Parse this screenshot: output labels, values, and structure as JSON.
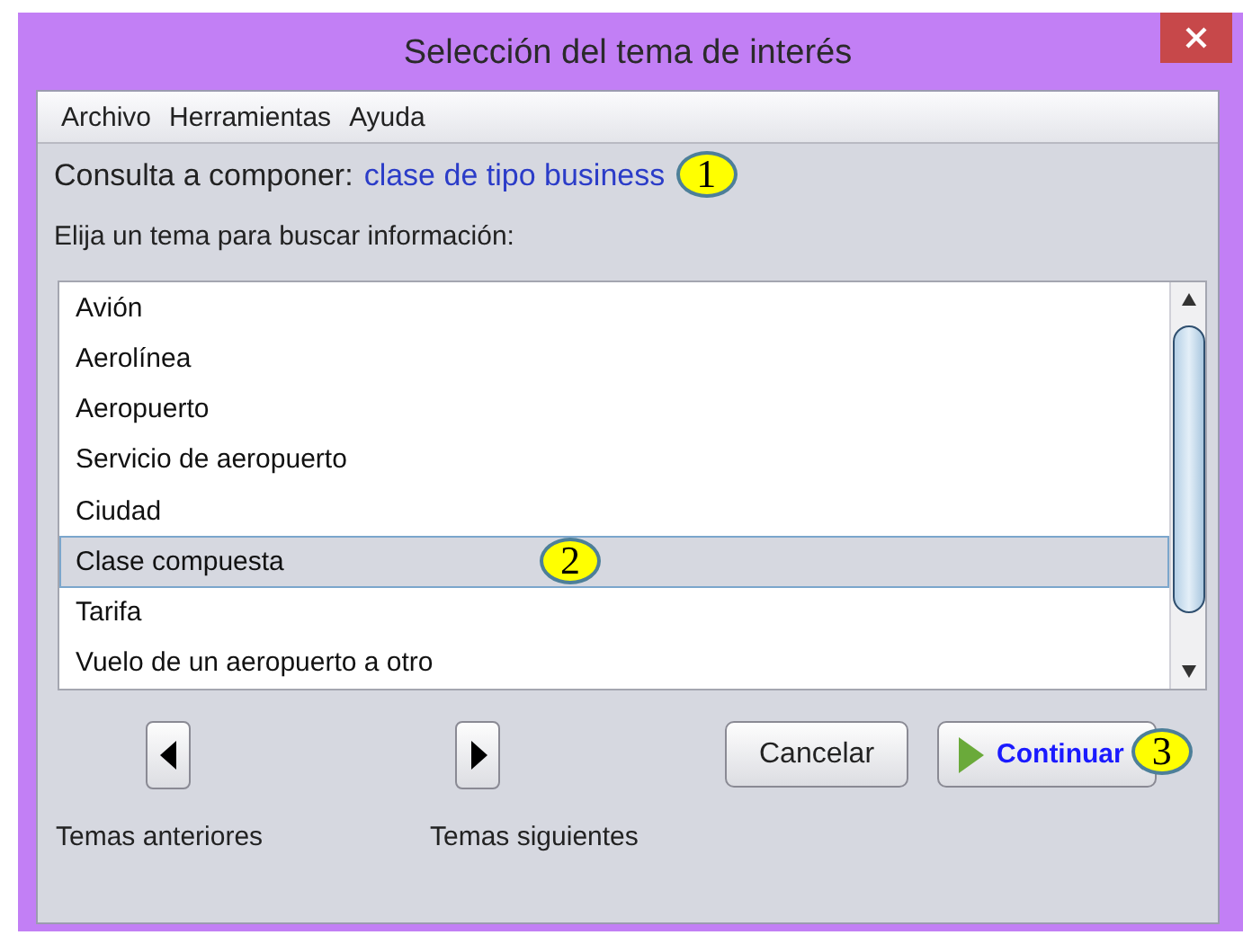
{
  "window": {
    "title": "Selección del tema de interés"
  },
  "menu": [
    {
      "label": "Archivo"
    },
    {
      "label": "Herramientas"
    },
    {
      "label": "Ayuda"
    }
  ],
  "query": {
    "label": "Consulta a componer:",
    "value": "clase de tipo business",
    "callout": "1"
  },
  "prompt": "Elija un tema para buscar información:",
  "topics": [
    {
      "label": "Avión",
      "selected": false
    },
    {
      "label": "Aerolínea",
      "selected": false
    },
    {
      "label": "Aeropuerto",
      "selected": false
    },
    {
      "label": "Servicio de aeropuerto",
      "selected": false
    },
    {
      "label": "Ciudad",
      "selected": false
    },
    {
      "label": "Clase compuesta",
      "selected": true,
      "callout": "2"
    },
    {
      "label": "Tarifa",
      "selected": false
    },
    {
      "label": "Vuelo de un aeropuerto a otro",
      "selected": false
    }
  ],
  "navigation": [
    {
      "label": "Temas anteriores",
      "kind": "previous"
    },
    {
      "label": "Temas siguientes",
      "kind": "next"
    }
  ],
  "buttons": [
    {
      "label": "Cancelar",
      "kind": "plain"
    },
    {
      "label": "Continuar",
      "kind": "primary",
      "callout": "3"
    }
  ]
}
